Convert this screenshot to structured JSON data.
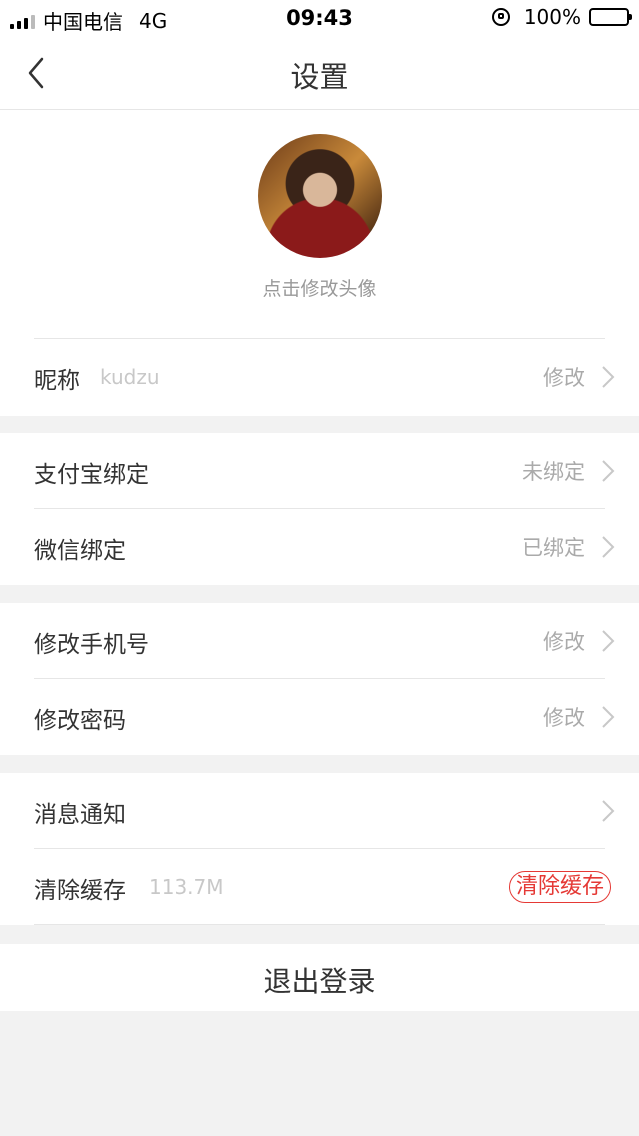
{
  "status_bar": {
    "carrier": "中国电信",
    "network": "4G",
    "time": "09:43",
    "battery_percent": "100%",
    "battery_level": 1.0
  },
  "nav": {
    "title": "设置"
  },
  "profile": {
    "avatar_caption": "点击修改头像"
  },
  "nickname_row": {
    "label": "昵称",
    "value": "kudzu",
    "action": "修改"
  },
  "alipay_row": {
    "label": "支付宝绑定",
    "status": "未绑定"
  },
  "wechat_row": {
    "label": "微信绑定",
    "status": "已绑定"
  },
  "phone_row": {
    "label": "修改手机号",
    "action": "修改"
  },
  "password_row": {
    "label": "修改密码",
    "action": "修改"
  },
  "notify_row": {
    "label": "消息通知"
  },
  "cache_row": {
    "label": "清除缓存",
    "size": "113.7M",
    "button": "清除缓存"
  },
  "logout": {
    "label": "退出登录"
  },
  "colors": {
    "accent_red": "#e53935",
    "background": "#f2f2f2"
  }
}
